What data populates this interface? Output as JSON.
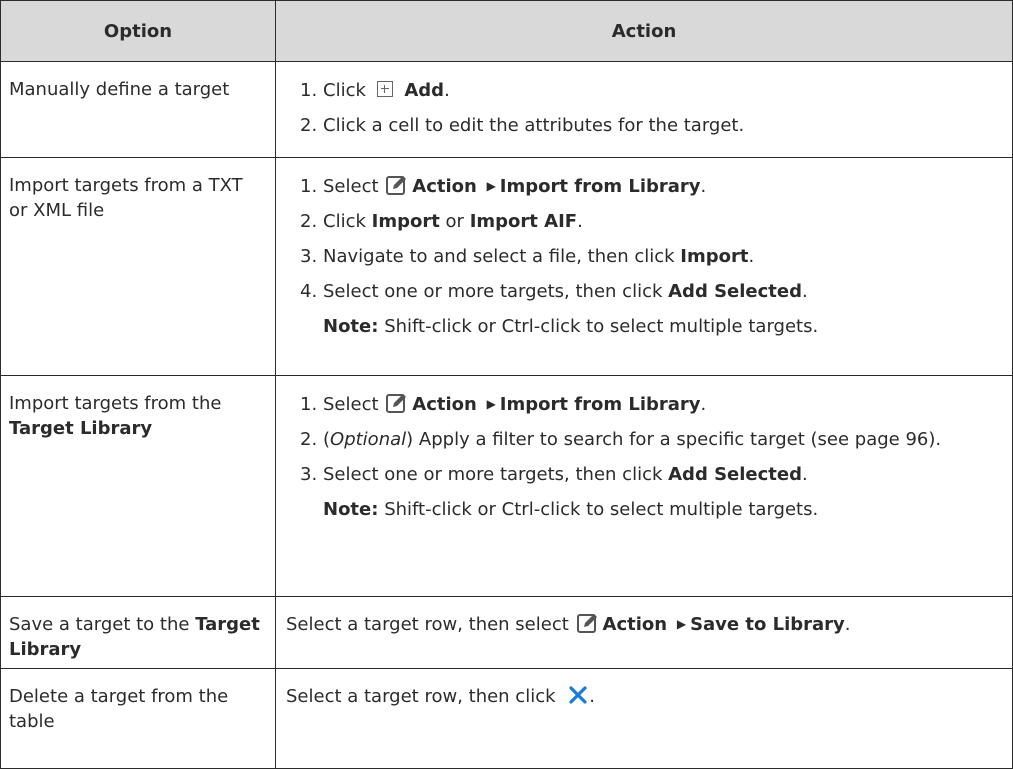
{
  "table": {
    "headers": {
      "option": "Option",
      "action": "Action"
    },
    "row1": {
      "option": "Manually define a target",
      "step1": {
        "num": "1.",
        "prefix": "Click",
        "bold": "Add",
        "suffix": "."
      },
      "step2": {
        "num": "2.",
        "text": "Click a cell to edit the attributes for the target."
      }
    },
    "row2": {
      "option": "Import targets from a TXT or XML file",
      "step1": {
        "num": "1.",
        "prefix": "Select",
        "bold1": "Action",
        "bold2": "Import from Library",
        "suffix": "."
      },
      "step2": {
        "num": "2.",
        "prefix": "Click",
        "bold1": "Import",
        "mid": "or",
        "bold2": "Import AIF",
        "suffix": "."
      },
      "step3": {
        "num": "3.",
        "prefix": "Navigate to and select a file, then click",
        "bold": "Import",
        "suffix": "."
      },
      "step4": {
        "num": "4.",
        "prefix": "Select one or more targets, then click",
        "bold": "Add Selected",
        "suffix": "."
      },
      "note": {
        "label": "Note:",
        "text": "Shift-click or Ctrl-click to select multiple targets."
      }
    },
    "row3": {
      "option_text": "Import targets from the",
      "option_bold": "Target Library",
      "step1": {
        "num": "1.",
        "prefix": "Select",
        "bold1": "Action",
        "bold2": "Import from Library",
        "suffix": "."
      },
      "step2": {
        "num": "2.",
        "open": "(",
        "italic": "Optional",
        "close": ")",
        "text": "Apply a filter to search for a specific target (see page 96)."
      },
      "step3": {
        "num": "3.",
        "prefix": "Select one or more targets, then click",
        "bold": "Add Selected",
        "suffix": "."
      },
      "note": {
        "label": "Note:",
        "text": "Shift-click or Ctrl-click to select multiple targets."
      }
    },
    "row4": {
      "option_text": "Save a target to the",
      "option_bold": "Target Library",
      "action": {
        "prefix": "Select a target row, then select",
        "bold1": "Action",
        "bold2": "Save to Library",
        "suffix": "."
      }
    },
    "row5": {
      "option": "Delete a target from the table",
      "action": {
        "prefix": "Select a target row, then click",
        "suffix": "."
      }
    }
  },
  "icons": {
    "add": "add-icon",
    "edit": "edit-icon",
    "arrow": "arrow-right-icon",
    "delete": "close-icon"
  },
  "colors": {
    "header_bg": "#d9d9d9",
    "text": "#2b2b2b",
    "close_icon": "#1a7ad9"
  }
}
